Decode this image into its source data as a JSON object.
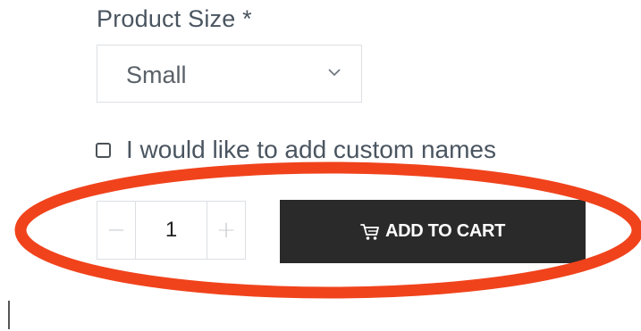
{
  "product_form": {
    "size_label": "Product Size *",
    "size_selected": "Small",
    "custom_names_label": "I would like to add custom names",
    "custom_names_checked": false,
    "quantity": "1",
    "quantity_minus": "−",
    "quantity_plus": "+",
    "add_to_cart_label": "ADD TO CART"
  },
  "icons": {
    "dropdown": "chevron-down-icon",
    "cart": "cart-icon"
  },
  "colors": {
    "button_bg": "#2a2a2a",
    "button_text": "#ffffff",
    "highlight_ellipse": "#f0431c",
    "label_text": "#4a5560",
    "border": "#dcdfe3"
  }
}
